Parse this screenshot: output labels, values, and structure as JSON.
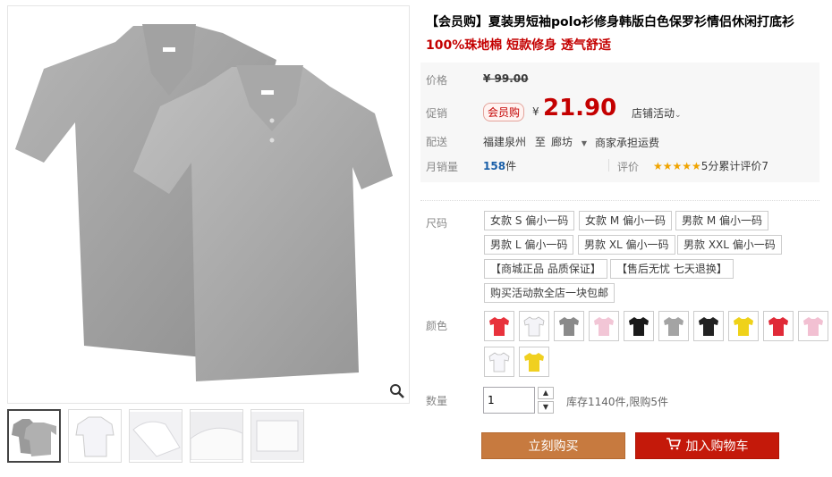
{
  "product": {
    "title": "【会员购】夏装男短袖polo衫修身韩版白色保罗衫情侣休闲打底衫",
    "subtitle": "100%珠地棉 短款修身 透气舒适"
  },
  "price": {
    "label": "价格",
    "old_value": "¥ 99.00"
  },
  "promo": {
    "label": "促销",
    "badge": "会员购",
    "currency": "¥",
    "value": "21.90",
    "store_event": "店铺活动"
  },
  "shipping": {
    "label": "配送",
    "from": "福建泉州",
    "to_word": "至",
    "to": "廊坊",
    "fee": "商家承担运费"
  },
  "sales": {
    "label": "月销量",
    "count": "158",
    "unit": "件",
    "rating_label": "评价",
    "stars": "★★★★★",
    "rating": "5分累计评价7"
  },
  "size": {
    "label": "尺码",
    "options": [
      "女款 S 偏小一码",
      "女款 M 偏小一码",
      "男款 M 偏小一码",
      "男款 L 偏小一码",
      "男款 XL 偏小一码",
      "男款 XXL 偏小一码",
      "【商城正品 品质保证】",
      "【售后无忧 七天退换】",
      "购买活动款全店一块包邮"
    ]
  },
  "color": {
    "label": "颜色",
    "swatches": [
      "#e8323c",
      "#f4f4f8",
      "#8a8a8a",
      "#f2c6d6",
      "#1a1a1a",
      "#a4a4a4",
      "#222222",
      "#efd21a",
      "#e02a38",
      "#f2c0d2",
      "#f6f6fa",
      "#f0d020"
    ]
  },
  "quantity": {
    "label": "数量",
    "value": "1",
    "stock": "库存1140件,限购5件"
  },
  "actions": {
    "buy_now": "立刻购买",
    "add_cart": "加入购物车"
  },
  "icons": {
    "zoom": "magnifier-icon",
    "cart": "cart-icon",
    "dropdown": "chevron-down-icon"
  },
  "colors": {
    "accent_red": "#c40000",
    "buy_button": "#c77a3f",
    "cart_button": "#c4190a"
  }
}
